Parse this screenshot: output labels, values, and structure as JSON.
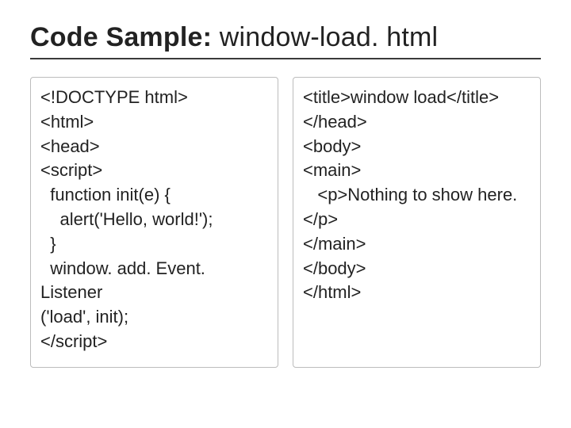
{
  "title": {
    "bold": "Code Sample:",
    "rest": " window-load. html"
  },
  "left_code": "<!DOCTYPE html>\n<html>\n<head>\n<script>\n  function init(e) {\n    alert('Hello, world!');\n  }\n  window. add. Event. Listener\n('load', init);\n</script>",
  "right_code": "<title>window load</title>\n</head>\n<body>\n<main>\n   <p>Nothing to show here. </p>\n</main>\n</body>\n</html>"
}
